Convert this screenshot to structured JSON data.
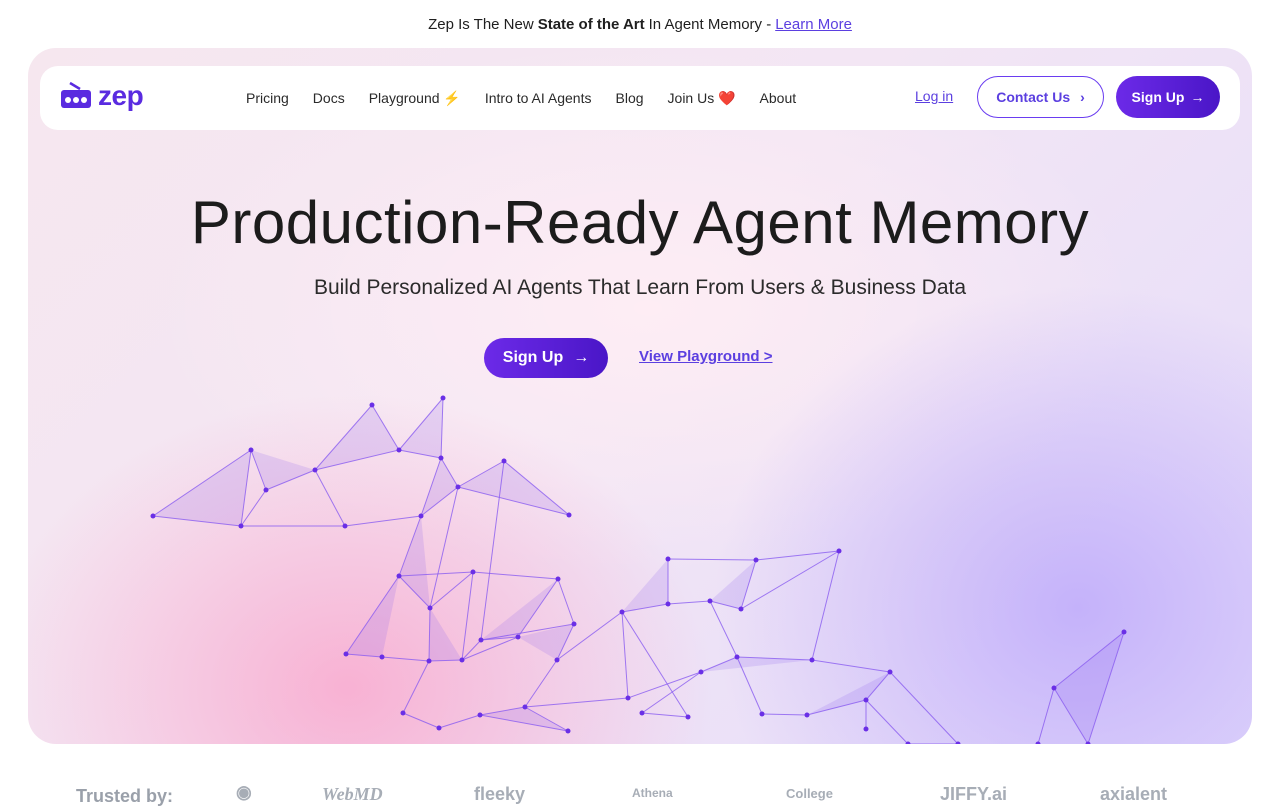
{
  "announcement": {
    "prefix": "Zep Is The New",
    "bold": "State of the Art",
    "middle": "In Agent Memory -",
    "link": "Learn More"
  },
  "nav": {
    "logo": "zep",
    "items": [
      "Pricing",
      "Docs",
      "Playground ⚡",
      "Intro to AI Agents",
      "Blog",
      "Join Us ❤️",
      "About"
    ],
    "login": "Log in",
    "contact": "Contact Us",
    "signup": "Sign Up"
  },
  "hero": {
    "title": "Production-Ready Agent Memory",
    "subtitle": "Build Personalized AI Agents That Learn From Users & Business Data",
    "signup": "Sign Up",
    "playground": "View Playground >"
  },
  "trusted": {
    "label": "Trusted by:",
    "clients": [
      "WebMD",
      "fleeky",
      "Athena",
      "College",
      "JIFFY.ai",
      "axialent"
    ]
  },
  "colors": {
    "accent": "#5b3fe0",
    "button_gradient_start": "#6c2ae8",
    "button_gradient_end": "#4a16c7",
    "mesh_stroke": "#8a5cf0"
  }
}
